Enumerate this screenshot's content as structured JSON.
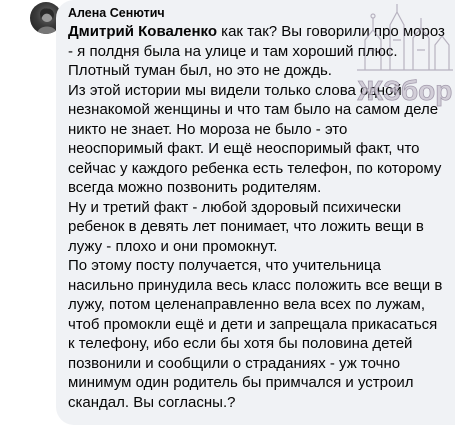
{
  "comment": {
    "author": "Алена Сенютич",
    "mention": "Дмитрий Коваленко",
    "text_after_mention": " как так? Вы говорили про мороз - я полдня была на улице и там хороший плюс. Плотный туман был, но это не дождь.\nИз этой истории мы видели только слова одной незнакомой женщины и что там было на самом деле никто не знает. Но мороза не было - это неоспоримый факт. И ещё неоспоримый факт, что сейчас у каждого ребенка есть телефон, по которому всегда можно позвонить родителям.\nНу и третий факт - любой здоровый психически ребенок в девять лет понимает, что ложить вещи в лужу - плохо и они промокнут.\nПо этому посту получается, что учительница насильно принудила весь класс положить все вещи в лужу, потом целенаправленно вела всех по лужам, чтоб промокли ещё и дети и запрещала прикасаться к телефону, ибо если бы хотя бы половина детей позвонили и сообщили о страданиях - уж точно минимум один родитель бы примчался и устроил скандал. Вы согласны.?"
  },
  "watermark": {
    "text": "ЖЗбор"
  }
}
